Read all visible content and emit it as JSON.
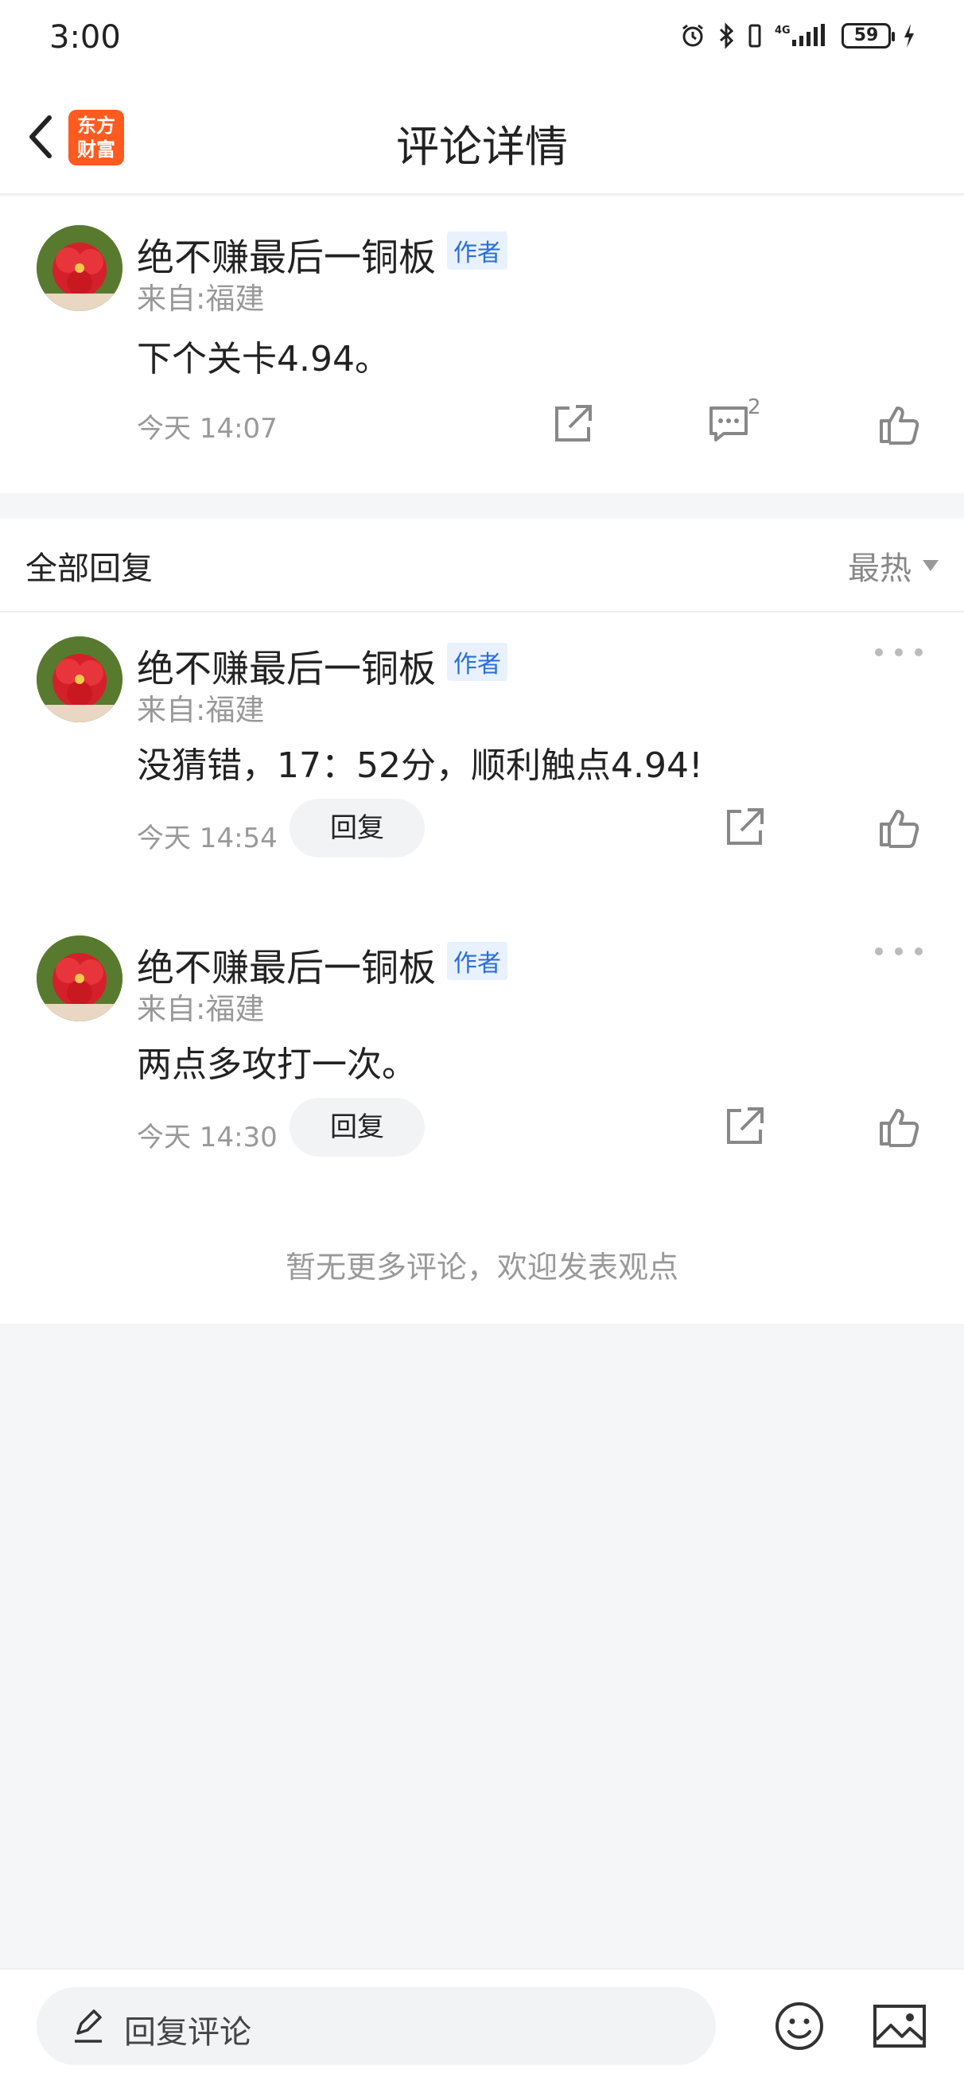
{
  "status_bar": {
    "time": "3:00",
    "battery": "59"
  },
  "nav": {
    "title": "评论详情",
    "logo_text_line1": "东方",
    "logo_text_line2": "财富"
  },
  "main_comment": {
    "author": "绝不赚最后一铜板",
    "badge": "作者",
    "location": "来自:福建",
    "text": "下个关卡4.94。",
    "time": "今天 14:07",
    "reply_count": "2"
  },
  "replies": {
    "title": "全部回复",
    "sort_label": "最热",
    "items": [
      {
        "author": "绝不赚最后一铜板",
        "badge": "作者",
        "location": "来自:福建",
        "text": "没猜错，17：52分，顺利触点4.94!",
        "time": "今天 14:54",
        "reply_label": "回复"
      },
      {
        "author": "绝不赚最后一铜板",
        "badge": "作者",
        "location": "来自:福建",
        "text": "两点多攻打一次。",
        "time": "今天 14:30",
        "reply_label": "回复"
      }
    ],
    "no_more": "暂无更多评论，欢迎发表观点"
  },
  "bottom_bar": {
    "placeholder": "回复评论"
  },
  "colors": {
    "brand": "#ff5a1f",
    "badge_text": "#2a6fd6",
    "badge_bg": "#e8f1fd"
  }
}
